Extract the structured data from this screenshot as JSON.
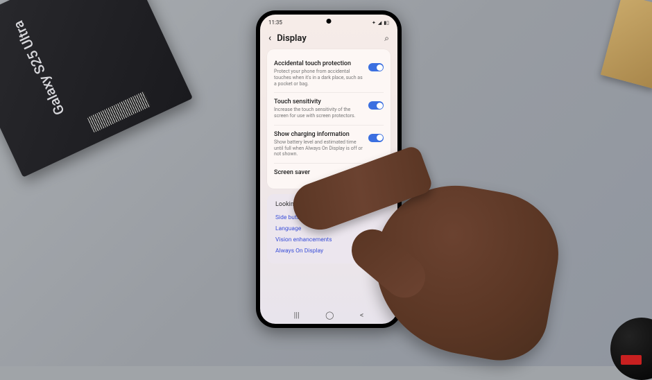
{
  "box": {
    "product_name": "Galaxy S25 Ultra"
  },
  "statusbar": {
    "time": "11:35",
    "battery_icon": "▮▯",
    "signal": "◢",
    "wifi": "✦"
  },
  "header": {
    "title": "Display",
    "back_glyph": "‹",
    "search_glyph": "⌕"
  },
  "settings": [
    {
      "title": "Accidental touch protection",
      "sub": "Protect your phone from accidental touches when it's in a dark place, such as a pocket or bag.",
      "toggle": true
    },
    {
      "title": "Touch sensitivity",
      "sub": "Increase the touch sensitivity of the screen for use with screen protectors.",
      "toggle": true
    },
    {
      "title": "Show charging information",
      "sub": "Show battery level and estimated time until full when Always On Display is off or not shown.",
      "toggle": true
    },
    {
      "title": "Screen saver",
      "sub": "",
      "toggle": false
    }
  ],
  "footer": {
    "heading": "Looking for something else?",
    "links": [
      "Side button",
      "Language",
      "Vision enhancements",
      "Always On Display"
    ]
  },
  "nav": {
    "recents": "|||",
    "home": "◯",
    "back": "<"
  }
}
